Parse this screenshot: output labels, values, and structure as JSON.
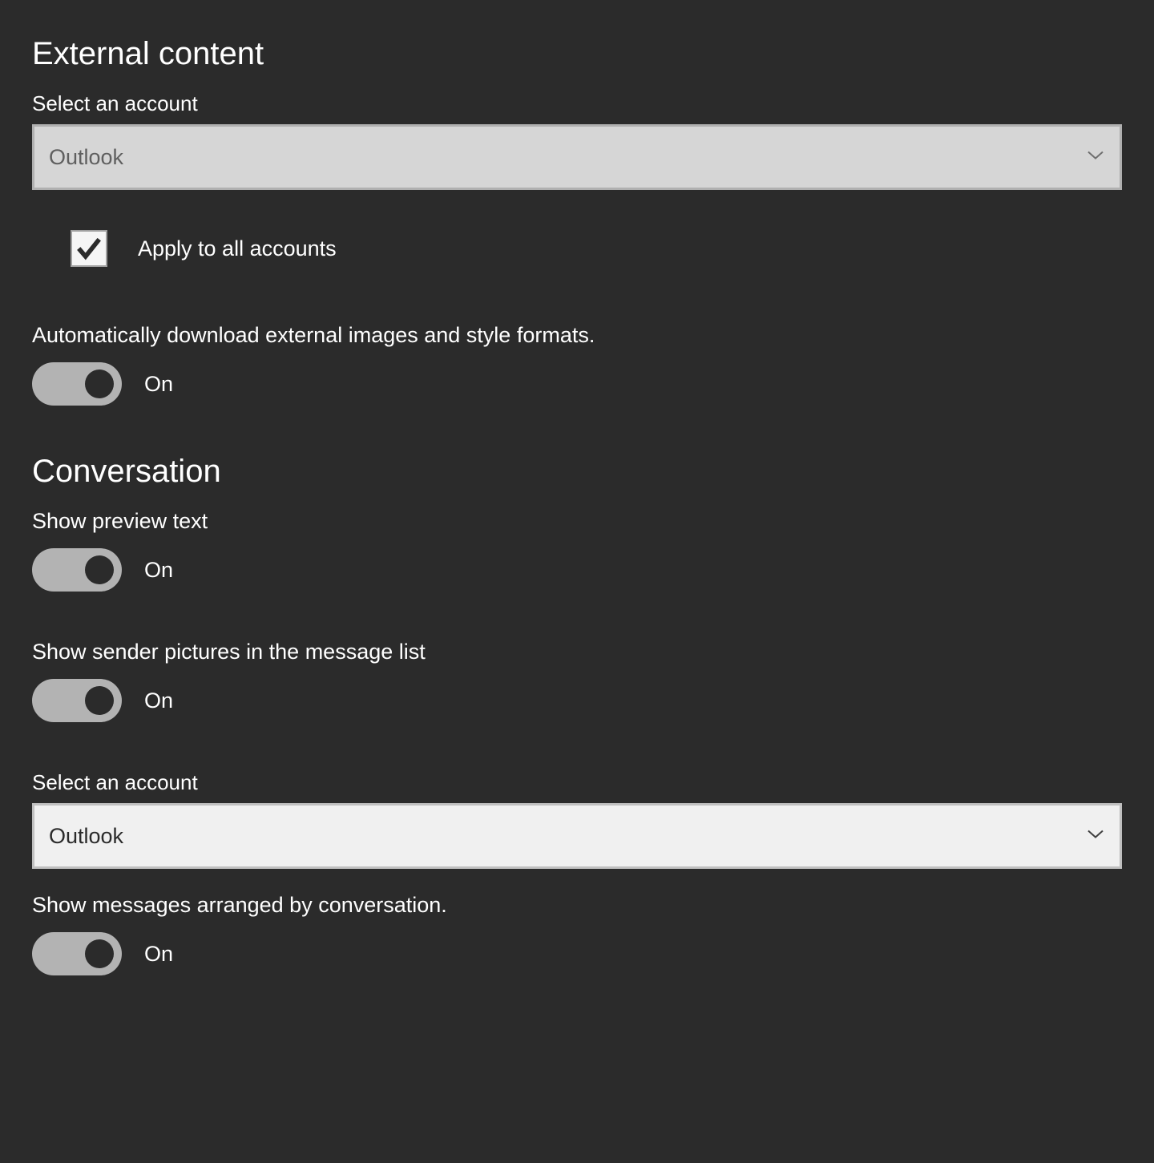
{
  "external_content": {
    "title": "External content",
    "select_label": "Select an account",
    "select_value": "Outlook",
    "apply_all_label": "Apply to all accounts",
    "apply_all_checked": true,
    "auto_download_label": "Automatically download external images and style formats.",
    "auto_download_state": "On"
  },
  "conversation": {
    "title": "Conversation",
    "preview_text_label": "Show preview text",
    "preview_text_state": "On",
    "sender_pictures_label": "Show sender pictures in the message list",
    "sender_pictures_state": "On",
    "select_label": "Select an account",
    "select_value": "Outlook",
    "arranged_label": "Show messages arranged by conversation.",
    "arranged_state": "On"
  }
}
